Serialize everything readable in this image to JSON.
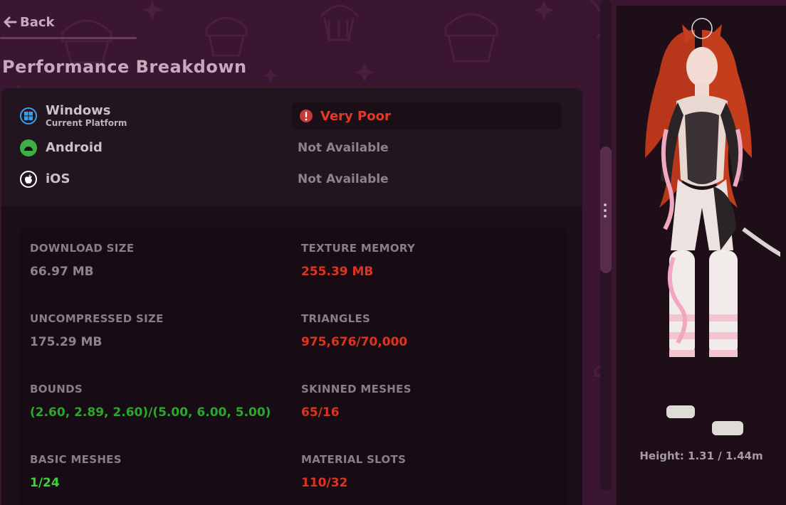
{
  "nav": {
    "back_label": "Back"
  },
  "page": {
    "title": "Performance Breakdown"
  },
  "platforms": [
    {
      "name": "Windows",
      "subtitle": "Current Platform",
      "status": "Very Poor",
      "icon": "windows-icon",
      "color": "#3aa0e8"
    },
    {
      "name": "Android",
      "subtitle": "",
      "status": "Not Available",
      "icon": "android-icon",
      "color": "#3cb043"
    },
    {
      "name": "iOS",
      "subtitle": "",
      "status": "Not Available",
      "icon": "apple-icon",
      "color": "#ffffff"
    }
  ],
  "stats": {
    "download_size": {
      "label": "DOWNLOAD SIZE",
      "value": "66.97 MB"
    },
    "texture_memory": {
      "label": "TEXTURE MEMORY",
      "value": "255.39 MB"
    },
    "uncompressed_size": {
      "label": "UNCOMPRESSED SIZE",
      "value": "175.29 MB"
    },
    "triangles": {
      "label": "TRIANGLES",
      "value": "975,676/70,000"
    },
    "bounds": {
      "label": "BOUNDS",
      "value": "(2.60, 2.89, 2.60)/(5.00, 6.00, 5.00)"
    },
    "skinned_meshes": {
      "label": "SKINNED MESHES",
      "value": "65/16"
    },
    "basic_meshes": {
      "label": "BASIC MESHES",
      "value": "1/24"
    },
    "material_slots": {
      "label": "MATERIAL SLOTS",
      "value": "110/32"
    }
  },
  "preview": {
    "height_label": "Height: 1.31 / 1.44m"
  },
  "colors": {
    "background": "#3a1630",
    "panel": "#1a0f16",
    "bad": "#dd3420",
    "good": "#2fa52f",
    "good_light": "#3cd13c",
    "neutral": "#8f838b"
  }
}
